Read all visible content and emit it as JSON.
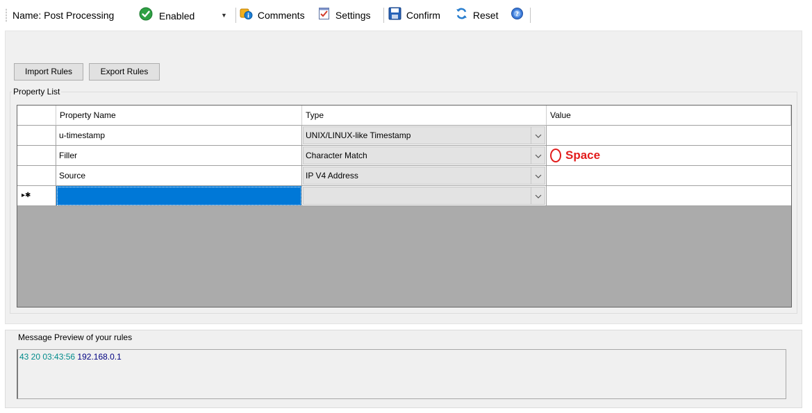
{
  "toolbar": {
    "name_label": "Name: Post Processing",
    "status_value": "Enabled",
    "comments_label": "Comments",
    "settings_label": "Settings",
    "confirm_label": "Confirm",
    "reset_label": "Reset"
  },
  "buttons": {
    "import_label": "Import Rules",
    "export_label": "Export Rules"
  },
  "property_list": {
    "title": "Property List",
    "columns": {
      "name": "Property Name",
      "type": "Type",
      "value": "Value"
    },
    "rows": [
      {
        "name": "u-timestamp",
        "type": "UNIX/LINUX-like Timestamp",
        "value": ""
      },
      {
        "name": "Filler",
        "type": "Character Match",
        "value": ""
      },
      {
        "name": "Source",
        "type": "IP V4 Address",
        "value": ""
      }
    ],
    "new_row_marker": "▸✱",
    "annotation": "Space"
  },
  "preview": {
    "title": "Message Preview of your rules",
    "segments": [
      {
        "text": "43 20 03:43:56",
        "color": "#008b8b"
      },
      {
        "text": "192.168.0.1",
        "color": "#000080"
      }
    ]
  },
  "colors": {
    "selection": "#0078d7",
    "annotation": "#e21c1c",
    "grid_empty": "#ababab"
  }
}
